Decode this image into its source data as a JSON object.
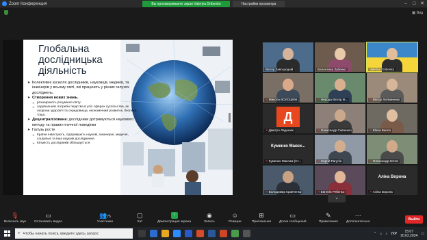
{
  "window": {
    "title": "Zoom Конференция"
  },
  "banner": {
    "share_text": "Вы просматриваете экран Valeriya Gribenko",
    "view_options": "Настройки просмотра"
  },
  "view_label": "Вид",
  "slide": {
    "title_line1": "Глобальна",
    "title_line2": "дослідницька",
    "title_line3": "діяльність",
    "bullets": [
      {
        "text": "Колективні зусилля дослідників, науковців, медиків, та інженерів у всьому світі, які працюють у різних галузях досліджень."
      },
      {
        "bold": "Створення нових знань",
        "text": ","
      },
      {
        "sub": "розширюють розуміння світу"
      },
      {
        "sub": "задовольняє потреби людства в усіх сферах суспільства, як охорона здоров'я та середовища, економічний розвиток, безпека, тощо."
      },
      {
        "bold": "Децентралізована",
        "text": ": дослідники дотримуються наукового методу та правил етичної поведінки"
      },
      {
        "text": "Галузь росте"
      },
      {
        "sub": "Країни інвестують, підтримують наукові, інженерні, медичні, соціальні та інші наукові дослідження."
      },
      {
        "sub": "Кількість дослідників збільшується"
      }
    ]
  },
  "participants": [
    {
      "name": "Віктор Завгородній",
      "muted": false
    },
    {
      "name": "Валентина Зубенко",
      "muted": false
    },
    {
      "name": "Valeriya Gribenko",
      "muted": false,
      "active": true
    },
    {
      "name": "Микола ВОЛОШИН",
      "muted": true
    },
    {
      "name": "Нерода Віктор Ів...",
      "muted": true
    },
    {
      "name": "Віктор Литвиненко",
      "muted": true
    },
    {
      "name": "Дмитро Ладенюк",
      "muted": true,
      "avatar_letter": "Д"
    },
    {
      "name": "Олександр Савченко",
      "muted": true
    },
    {
      "name": "Elena Banno",
      "muted": true
    },
    {
      "name": "Куменко Максим (Ст...",
      "muted": true,
      "display_text": "Куменко Макси..."
    },
    {
      "name": "Сергій Рагулін",
      "muted": true
    },
    {
      "name": "Олександр Котов",
      "muted": true
    },
    {
      "name": "Володимир Кравченко",
      "muted": true
    },
    {
      "name": "Евгенія Ребенко",
      "muted": true
    },
    {
      "name": "Аліна Ворона",
      "muted": true,
      "display_text": "Аліна Ворона"
    }
  ],
  "toolbar": {
    "mic": "Включить звук",
    "video": "Остановить видео",
    "participants": "Участники",
    "participants_count": "75",
    "chat": "Чат",
    "share": "Демонстрация экрана",
    "record": "Запись",
    "reactions": "Реакции",
    "apps": "Приложения",
    "whiteboards": "Доски сообщений",
    "notes": "Примечания",
    "more": "Дополнительно",
    "leave": "Выйти"
  },
  "taskbar": {
    "search_placeholder": "Чтобы начать поиск, введите здесь запрос",
    "lang": "УКР",
    "time": "15:07",
    "date": "20.02.2024"
  },
  "colors": {
    "accent_green": "#1d9b3a",
    "leave_red": "#e02828",
    "active_outline": "#d8e85a"
  }
}
